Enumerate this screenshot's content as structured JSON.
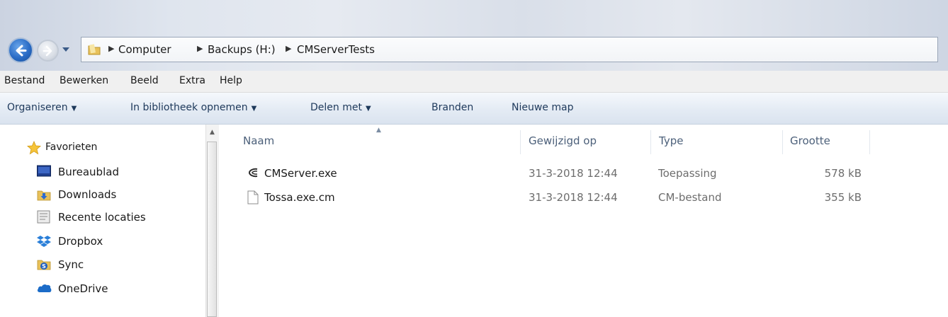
{
  "address": {
    "crumbs": [
      "Computer",
      "Backups (H:)",
      "CMServerTests"
    ]
  },
  "menu": [
    "Bestand",
    "Bewerken",
    "Beeld",
    "Extra",
    "Help"
  ],
  "toolbar": {
    "organize": "Organiseren",
    "include_library": "In bibliotheek opnemen",
    "share_with": "Delen met",
    "burn": "Branden",
    "new_folder": "Nieuwe map"
  },
  "nav": {
    "favorites": "Favorieten",
    "items": [
      "Bureaublad",
      "Downloads",
      "Recente locaties",
      "Dropbox",
      "Sync",
      "OneDrive"
    ]
  },
  "columns": {
    "name": "Naam",
    "modified": "Gewijzigd op",
    "type": "Type",
    "size": "Grootte"
  },
  "files": [
    {
      "name": "CMServer.exe",
      "modified": "31-3-2018 12:44",
      "type": "Toepassing",
      "size": "578 kB",
      "icon": "cmserver-app-icon"
    },
    {
      "name": "Tossa.exe.cm",
      "modified": "31-3-2018 12:44",
      "type": "CM-bestand",
      "size": "355 kB",
      "icon": "blank-file-icon"
    }
  ],
  "colors": {
    "toolbar_text": "#1e395b",
    "header_text": "#4c607a",
    "back_button": "#2a6cc6"
  }
}
